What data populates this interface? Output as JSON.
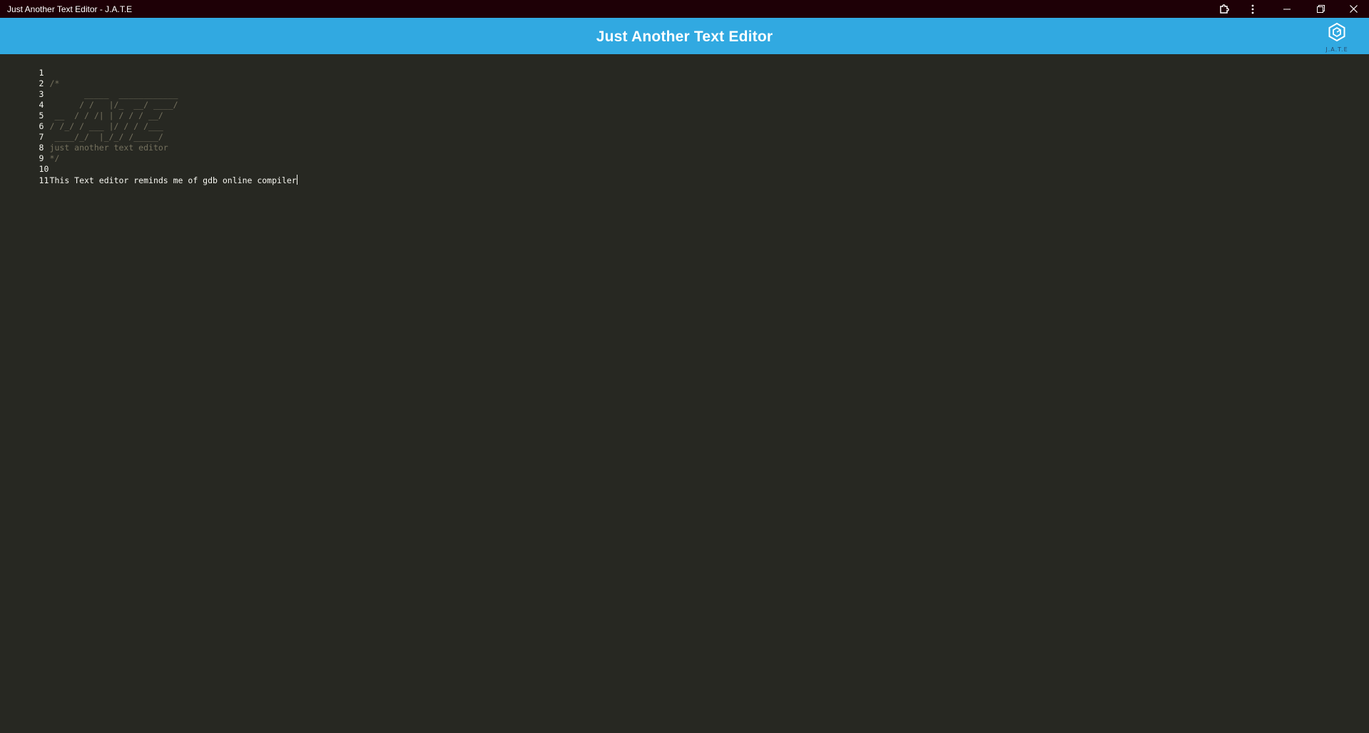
{
  "window": {
    "title": "Just Another Text Editor - J.A.T.E"
  },
  "header": {
    "title": "Just Another Text Editor",
    "logo_text": "J.A.T.E"
  },
  "icons": {
    "extensions": "puzzle-icon",
    "menu": "more-vertical-icon",
    "minimize": "minimize-icon",
    "restore": "restore-icon",
    "close": "close-icon",
    "logo": "hexagon-logo-icon"
  },
  "colors": {
    "titlebar": "#1e0006",
    "header": "#31a9e1",
    "editor_bg": "#272822",
    "text": "#f8f8f2",
    "comment": "#75715e"
  },
  "editor": {
    "lines": [
      {
        "num": "1",
        "text": "",
        "type": "code"
      },
      {
        "num": "2",
        "text": "/*",
        "type": "comment"
      },
      {
        "num": "3",
        "text": "       _____  ____________",
        "type": "comment"
      },
      {
        "num": "4",
        "text": "      / /   |/_  __/ ____/",
        "type": "comment"
      },
      {
        "num": "5",
        "text": " __  / / /| | / / / __/",
        "type": "comment"
      },
      {
        "num": "6",
        "text": "/ /_/ / ___ |/ / / /___",
        "type": "comment"
      },
      {
        "num": "7",
        "text": " ____/_/  |_/_/ /_____/",
        "type": "comment"
      },
      {
        "num": "8",
        "text": "just another text editor",
        "type": "comment"
      },
      {
        "num": "9",
        "text": "*/",
        "type": "comment"
      },
      {
        "num": "10",
        "text": "",
        "type": "code"
      },
      {
        "num": "11",
        "text": "This Text editor reminds me of gdb online compiler",
        "type": "code"
      }
    ]
  }
}
